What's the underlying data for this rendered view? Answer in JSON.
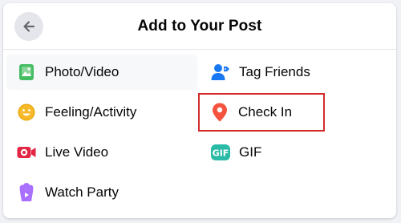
{
  "header": {
    "title": "Add to Your Post",
    "back_button": {
      "icon": "arrow-left-icon"
    }
  },
  "items": [
    {
      "id": "photo-video",
      "label": "Photo/Video",
      "icon": "photo-icon",
      "color": "#45bd62"
    },
    {
      "id": "tag-friends",
      "label": "Tag Friends",
      "icon": "tag-person-icon",
      "color": "#1877f2"
    },
    {
      "id": "feeling-activity",
      "label": "Feeling/Activity",
      "icon": "smiley-icon",
      "color": "#f7b928"
    },
    {
      "id": "check-in",
      "label": "Check In",
      "icon": "location-pin-icon",
      "color": "#f5533d",
      "highlighted": true
    },
    {
      "id": "live-video",
      "label": "Live Video",
      "icon": "live-camera-icon",
      "color": "#e42645"
    },
    {
      "id": "gif",
      "label": "GIF",
      "icon": "gif-icon",
      "color": "#2abba7"
    },
    {
      "id": "watch-party",
      "label": "Watch Party",
      "icon": "popcorn-icon",
      "color": "#a970ff"
    }
  ],
  "colors": {
    "highlight_border": "#d22c2c",
    "divider": "#e4e6eb"
  }
}
